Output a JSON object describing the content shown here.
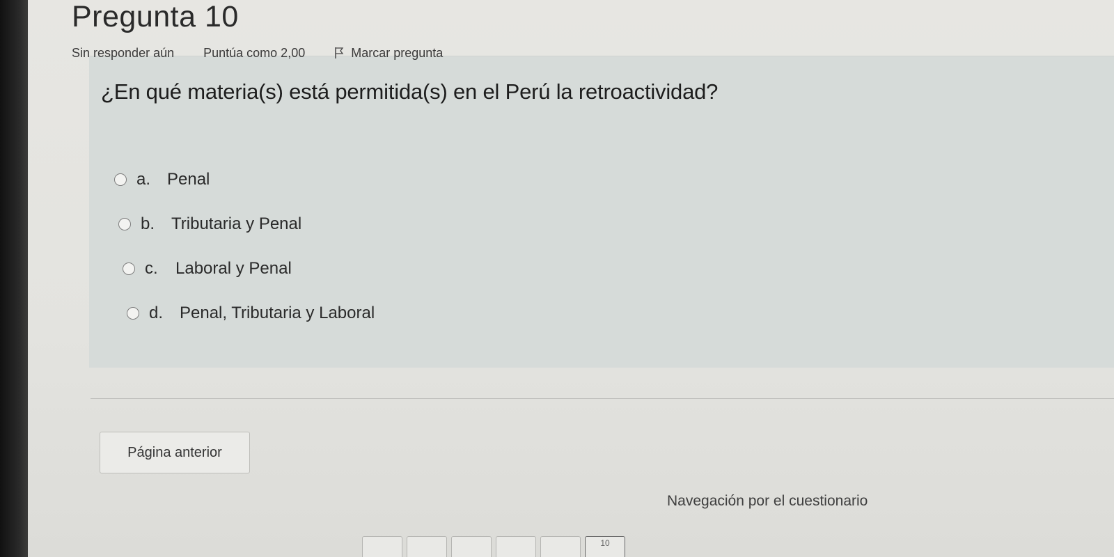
{
  "question": {
    "title": "Pregunta 10",
    "status": "Sin responder aún",
    "score": "Puntúa como 2,00",
    "flag_label": "Marcar pregunta",
    "text": "¿En qué materia(s) está permitida(s) en el Perú la retroactividad?",
    "answers": [
      {
        "letter": "a.",
        "label": "Penal"
      },
      {
        "letter": "b.",
        "label": "Tributaria y Penal"
      },
      {
        "letter": "c.",
        "label": "Laboral y Penal"
      },
      {
        "letter": "d.",
        "label": "Penal, Tributaria y Laboral"
      }
    ]
  },
  "navigation": {
    "prev_button": "Página anterior",
    "quiz_nav_title": "Navegación por el cuestionario",
    "current_page": "10"
  },
  "icons": {
    "flag": "flag-icon",
    "radio": "radio-icon"
  }
}
